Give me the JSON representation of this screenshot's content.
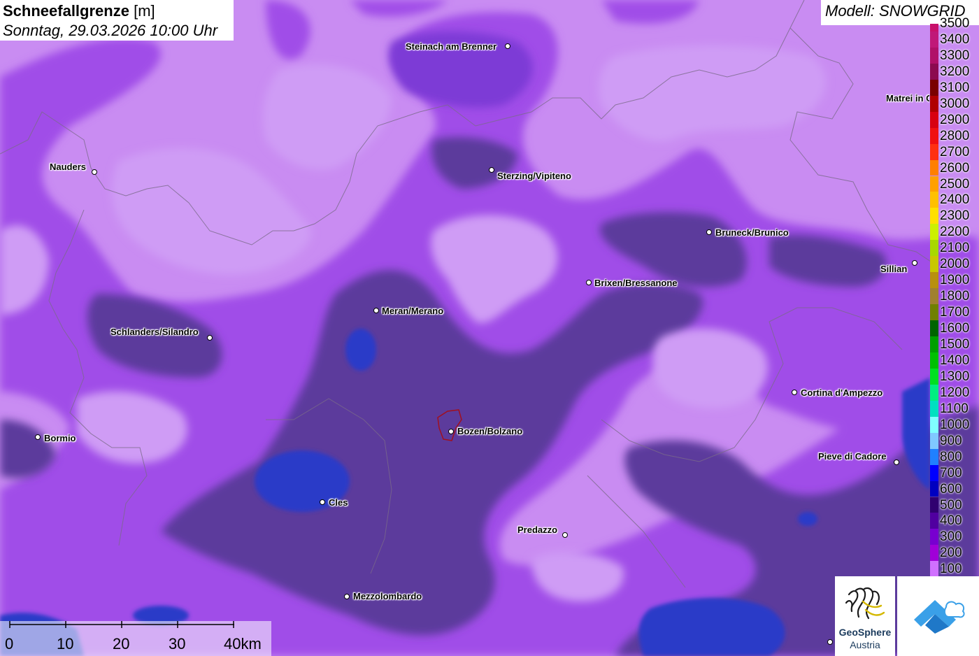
{
  "title": {
    "bold": "Schneefallgrenze",
    "unit": "[m]",
    "datetime": "Sonntag, 29.03.2026 10:00 Uhr"
  },
  "model": "Modell: SNOWGRID",
  "legend": {
    "values": [
      "3500",
      "3400",
      "3300",
      "3200",
      "3100",
      "3000",
      "2900",
      "2800",
      "2700",
      "2600",
      "2500",
      "2400",
      "2300",
      "2200",
      "2100",
      "2000",
      "1900",
      "1800",
      "1700",
      "1600",
      "1500",
      "1400",
      "1300",
      "1200",
      "1100",
      "1000",
      "900",
      "800",
      "700",
      "600",
      "500",
      "400",
      "300",
      "200",
      "100"
    ],
    "colors": [
      "#c8106a",
      "#c01878",
      "#b01068",
      "#8c0a50",
      "#7a0000",
      "#b00000",
      "#d80010",
      "#f01010",
      "#ff3010",
      "#ff7f00",
      "#ffa000",
      "#ffc000",
      "#ffe000",
      "#ccf000",
      "#a8d800",
      "#c8c800",
      "#b89010",
      "#a08030",
      "#708000",
      "#006400",
      "#00a000",
      "#00c000",
      "#00e020",
      "#00ee80",
      "#00e0c0",
      "#80ffff",
      "#80c8ff",
      "#2080ff",
      "#0000ff",
      "#0000c0",
      "#300070",
      "#5000a0",
      "#7800d0",
      "#a000d8",
      "#d070ff"
    ]
  },
  "cities": [
    {
      "name": "Steinach am Brenner"
    },
    {
      "name": "Nauders"
    },
    {
      "name": "Sterzing/Vipiteno"
    },
    {
      "name": "Matrei in Osttirol"
    },
    {
      "name": "Bruneck/Brunico"
    },
    {
      "name": "Sillian"
    },
    {
      "name": "Brixen/Bressanone"
    },
    {
      "name": "Meran/Merano"
    },
    {
      "name": "Schlanders/Silandro"
    },
    {
      "name": "Cortina d'Ampezzo"
    },
    {
      "name": "Bormio"
    },
    {
      "name": "Bozen/Bolzano"
    },
    {
      "name": "Pieve di Cadore"
    },
    {
      "name": "Cles"
    },
    {
      "name": "Predazzo"
    },
    {
      "name": "Mezzolombardo"
    }
  ],
  "scale": {
    "ticks": [
      "0",
      "10",
      "20",
      "30",
      "40km"
    ]
  },
  "logo": {
    "line1": "GeoSphere",
    "line2": "Austria"
  },
  "colors": {
    "light_zone": "#c98cf2",
    "mid_zone": "#a050e8",
    "dark_zone": "#5c3a9c",
    "blue_zone": "#2a3ac8"
  }
}
